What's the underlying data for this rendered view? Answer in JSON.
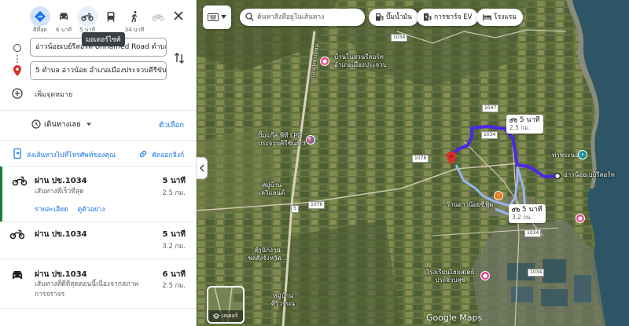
{
  "modes": [
    {
      "label": "ดีที่สุด",
      "icon": "directions-icon",
      "state": "active"
    },
    {
      "label": "6 นาที",
      "icon": "car-icon",
      "state": ""
    },
    {
      "label": "5 นาที",
      "icon": "motorcycle-icon",
      "state": "sel"
    },
    {
      "label": "",
      "icon": "transit-icon",
      "state": ""
    },
    {
      "label": "34 นาที",
      "icon": "walk-icon",
      "state": ""
    },
    {
      "label": "",
      "icon": "bicycle-icon",
      "state": "dis"
    }
  ],
  "tooltip": "มอเตอร์ไซค์",
  "origin": "อ่าวน้อยเบย์รีสอร์ท Unnamed Road ตำบล อ่",
  "destination": "5 ตำบล อ่าวน้อย อำเภอเมืองประจวบคีรีขันธ์ ปร",
  "add_destination": "เพิ่มจุดหมาย",
  "leave_now": "เดินทางเลย",
  "options": "ตัวเลือก",
  "send_to_phone": "ส่งเส้นทางไปที่โทรศัพท์ของคุณ",
  "copy_link": "คัดลอกลิงก์",
  "routes": [
    {
      "name": "ผ่าน ปข.1034",
      "desc": "เส้นทางที่เร็วที่สุด",
      "time": "5 นาที",
      "dist": "2.5 กม.",
      "details": "รายละเอียด",
      "preview": "ดูตัวอย่าง"
    },
    {
      "name": "ผ่าน ปข.1034",
      "desc": "",
      "time": "5 นาที",
      "dist": "3.2 กม."
    },
    {
      "name": "ผ่าน ปข.1034",
      "desc": "เส้นทางที่ดีที่สุดตอนนี้เนื่องจากสภาพการจราจร",
      "time": "6 นาที",
      "dist": "2.5 กม."
    }
  ],
  "map": {
    "search_placeholder": "ค้นหาสิ่งที่อยู่ในเส้นทาง",
    "chips": [
      "ปั๊มน้ำมัน",
      "การชาร์จ EV",
      "โรงแรม"
    ],
    "labels": {
      "resort_home": "บ้านในสวนรีสอร์ท\nอำเภอเมืองประจวบ",
      "lpg": "ปั๊มแก๊ส พีที LPG\nประจวบคีรีขันธ์ 3",
      "village1": "หมู่บ้าน\nเหวิแลนด์",
      "office": "สำนักงาน\nชลสั่งจังหวัด...",
      "village2": "หมู่บ้าน\nศิริวรรณ",
      "bay": "ท่าพระนอน",
      "dest_resort": "อ่าวน้อยเบย์รีสอร์ท",
      "restaurant": "ร้านอาวน้อยซีฟู้ด",
      "school": "โรงเรียนไฮมสเตย์\nประจวบสุข",
      "highway": "ถนนเพชรเกษม"
    },
    "roads": [
      "1034",
      "1047",
      "1034",
      "1076",
      "1076",
      "1034",
      "5",
      "1034"
    ],
    "callout1": {
      "time": "5 นาที",
      "dist": "2.5 กม."
    },
    "callout2": {
      "time": "5 นาที",
      "dist": "3.2 กม."
    },
    "layers_label": "เลเยอร์",
    "logo": "Google Maps"
  }
}
